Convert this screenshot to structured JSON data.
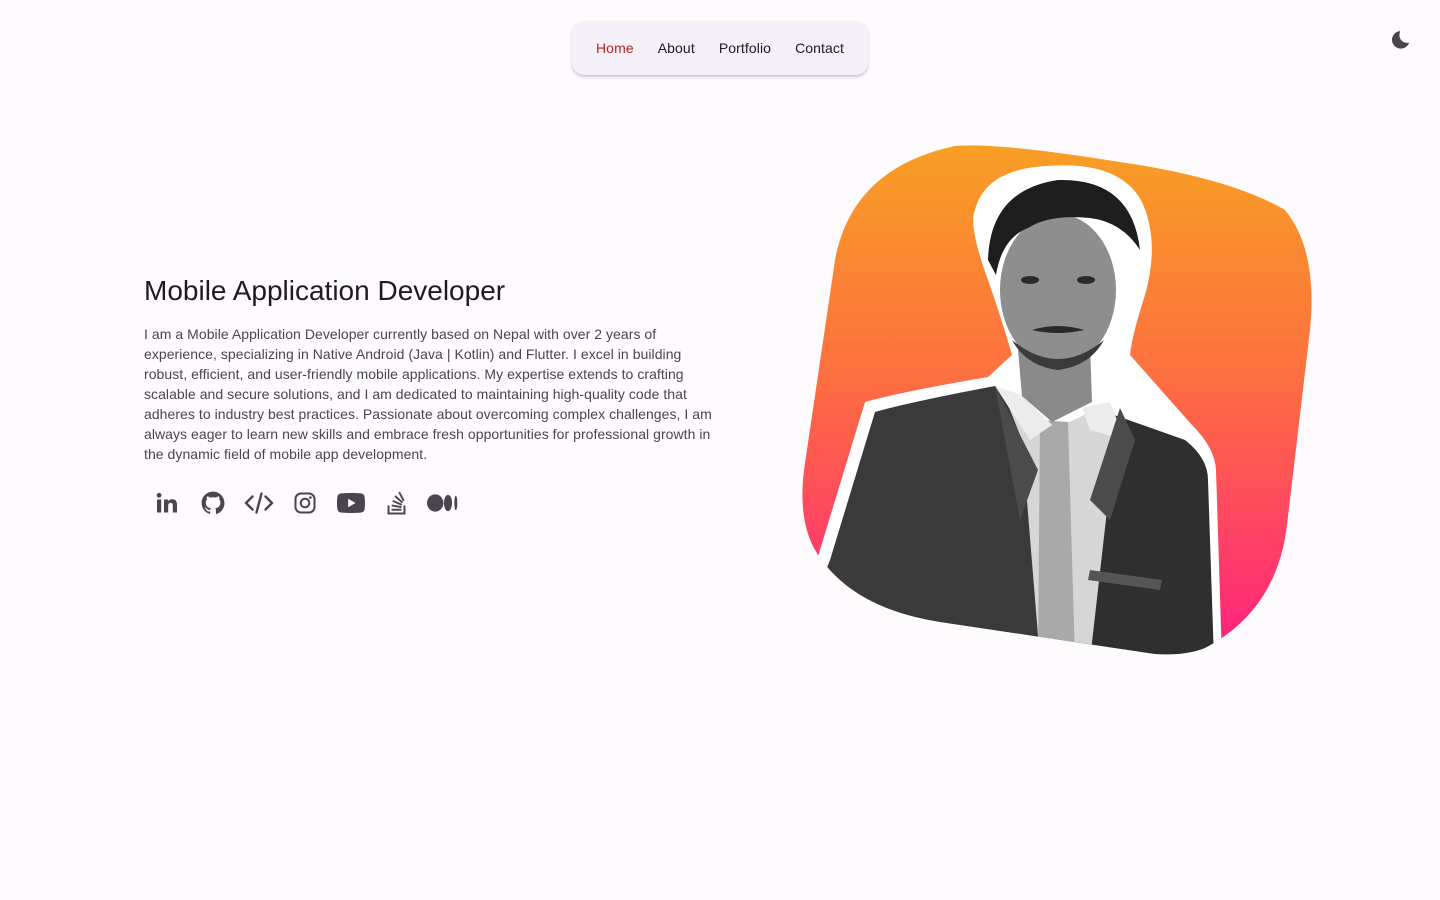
{
  "nav": {
    "items": [
      {
        "label": "Home",
        "active": true
      },
      {
        "label": "About",
        "active": false
      },
      {
        "label": "Portfolio",
        "active": false
      },
      {
        "label": "Contact",
        "active": false
      }
    ]
  },
  "theme_toggle": {
    "icon": "moon-icon"
  },
  "hero": {
    "headline": "Mobile Application Developer",
    "bio": "I am a Mobile Application Developer currently based on Nepal with over 2 years of experience, specializing in Native Android (Java | Kotlin) and Flutter. I excel in building robust, efficient, and user-friendly mobile applications. My expertise extends to crafting scalable and secure solutions, and I am dedicated to maintaining high-quality code that adheres to industry best practices. Passionate about overcoming complex challenges, I am always eager to learn new skills and embrace fresh opportunities for professional growth in the dynamic field of mobile app development."
  },
  "socials": [
    {
      "icon": "linkedin-icon"
    },
    {
      "icon": "github-icon"
    },
    {
      "icon": "code-icon"
    },
    {
      "icon": "instagram-icon"
    },
    {
      "icon": "youtube-icon"
    },
    {
      "icon": "stackoverflow-icon"
    },
    {
      "icon": "medium-icon"
    }
  ],
  "colors": {
    "background": "#fefbff",
    "nav_background": "#f4eff8",
    "active_nav": "#b3261e",
    "gradient_top": "#f8a024",
    "gradient_bottom": "#ff1f80",
    "icon": "#49454f"
  }
}
